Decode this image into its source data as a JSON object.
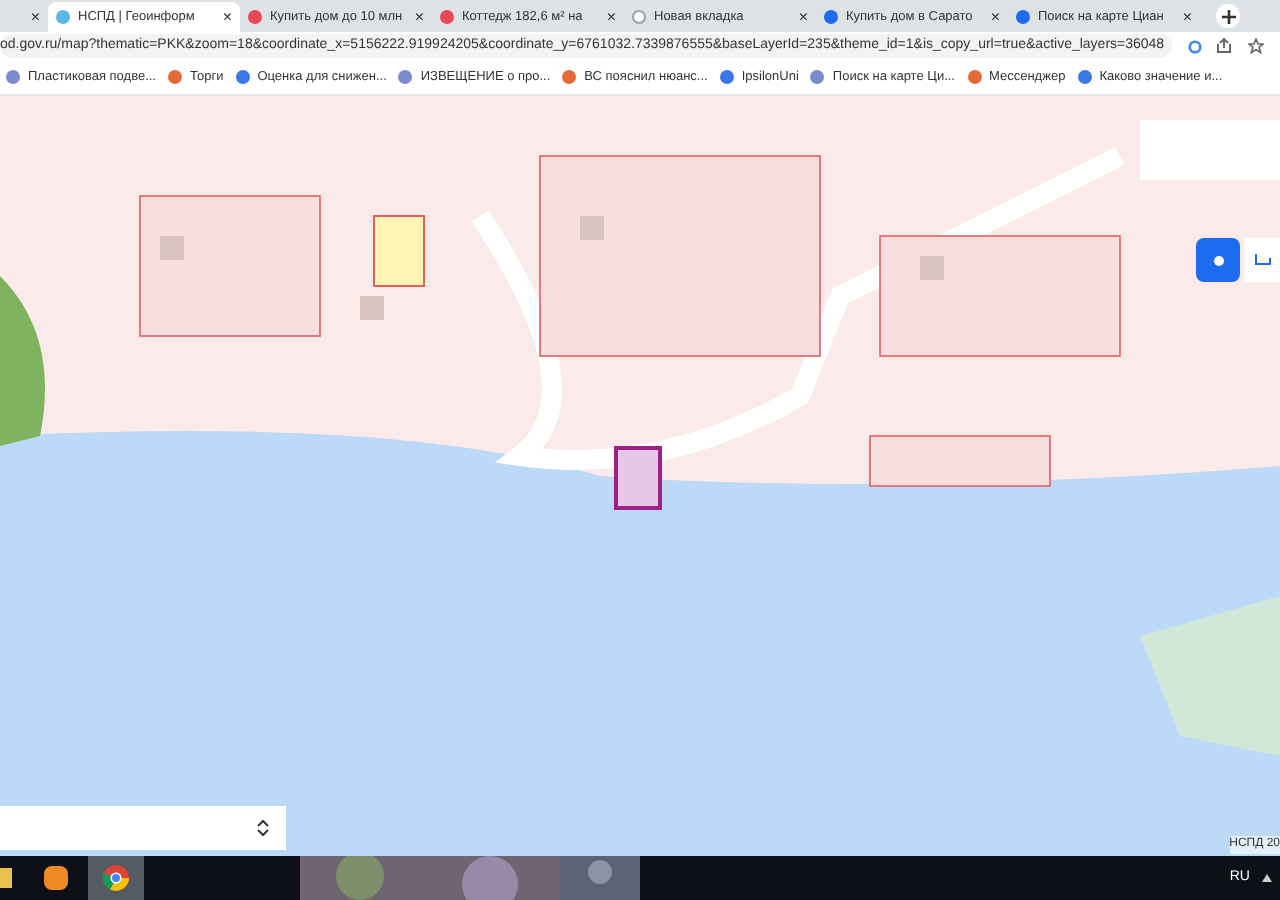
{
  "tabs": [
    {
      "close": "×",
      "selected": false
    },
    {
      "title": "НСПД | Геоинформ",
      "close": "×",
      "selected": true
    },
    {
      "title": "Купить дом до 10 млн",
      "close": "×",
      "selected": false
    },
    {
      "title": "Коттедж 182,6 м² на",
      "close": "×",
      "selected": false
    },
    {
      "title": "Новая вкладка",
      "close": "×",
      "selected": false
    },
    {
      "title": "Купить дом в Сарато",
      "close": "×",
      "selected": false
    },
    {
      "title": "Поиск на карте Циан",
      "close": "×",
      "selected": false
    }
  ],
  "address_bar": {
    "url": "od.gov.ru/map?thematic=PKK&zoom=18&coordinate_x=5156222.919924205&coordinate_y=6761032.7339876555&baseLayerId=235&theme_id=1&is_copy_url=true&active_layers=36048"
  },
  "bookmarks": [
    "Пластиковая подве...",
    "Торги",
    "Оценка для снижен...",
    "ИЗВЕЩЕНИЕ о про...",
    "ВС пояснил нюанс...",
    "IpsilonUni",
    "Поиск на карте Ци...",
    "Мессенджер",
    "Каково значение и..."
  ],
  "map": {
    "kind": "picture",
    "attribution": "НСПД 20"
  },
  "taskbar": {
    "language": "RU"
  }
}
